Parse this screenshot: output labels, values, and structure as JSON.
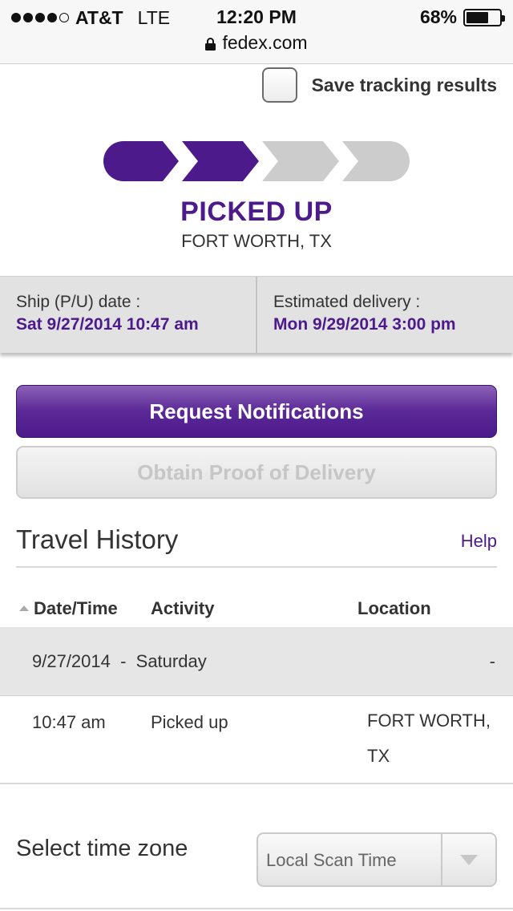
{
  "status_bar": {
    "carrier": "AT&T",
    "network": "LTE",
    "time": "12:20 PM",
    "battery": "68%",
    "battery_level": 0.68,
    "url": "fedex.com"
  },
  "save_tracking": {
    "label": "Save tracking results",
    "checked": false
  },
  "progress": {
    "steps_total": 4,
    "steps_completed": 2,
    "active_color": "#4d1a8c",
    "inactive_color": "#cccccc"
  },
  "shipment": {
    "status": "PICKED UP",
    "location": "FORT WORTH, TX"
  },
  "dates": {
    "ship_label": "Ship (P/U) date :",
    "ship_value": "Sat 9/27/2014 10:47 am",
    "delivery_label": "Estimated delivery :",
    "delivery_value": "Mon 9/29/2014 3:00 pm"
  },
  "buttons": {
    "request_notifications": "Request Notifications",
    "proof_of_delivery": "Obtain Proof of Delivery"
  },
  "travel_history": {
    "title": "Travel History",
    "help": "Help",
    "columns": {
      "datetime": "Date/Time",
      "activity": "Activity",
      "location": "Location"
    },
    "day_header": {
      "text": "9/27/2014  -  Saturday",
      "location": "-"
    },
    "events": [
      {
        "time": "10:47 am",
        "activity": "Picked up",
        "location": "FORT WORTH, TX"
      }
    ]
  },
  "time_zone": {
    "label": "Select time zone",
    "selected": "Local Scan Time"
  },
  "colors": {
    "brand_purple": "#4d1a8c"
  }
}
